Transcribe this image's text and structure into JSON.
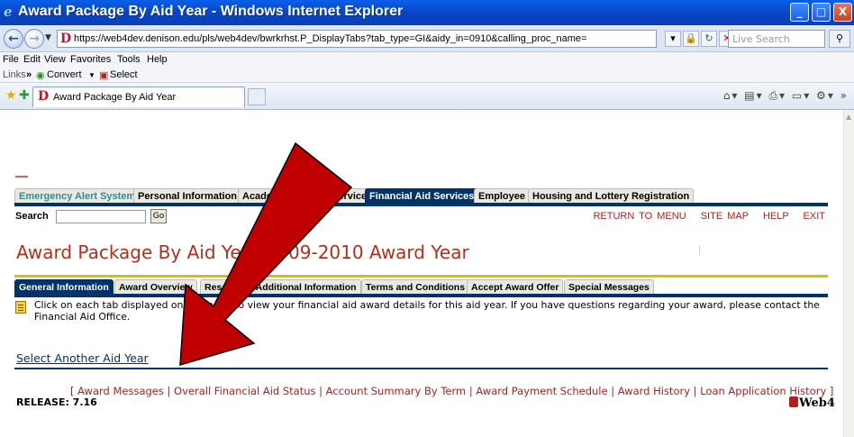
{
  "window": {
    "title": "Award Package By Aid Year - Windows Internet Explorer",
    "min_label": "_",
    "max_label": "□",
    "close_label": "X"
  },
  "address_bar": {
    "url": "https://web4dev.denison.edu/pls/web4dev/bwrkrhst.P_DisplayTabs?tab_type=GI&aidy_in=0910&calling_proc_name=",
    "search_placeholder": "Live Search"
  },
  "menu": {
    "items": [
      "File",
      "Edit",
      "View",
      "Favorites",
      "Tools",
      "Help"
    ],
    "links_label": "Links",
    "convert_label": "Convert",
    "select_label": "Select"
  },
  "browser_tab": {
    "title": "Award Package By Aid Year"
  },
  "site_tabs": [
    {
      "label": "Emergency Alert System"
    },
    {
      "label": "Personal Information"
    },
    {
      "label": "Academic/Student Services"
    },
    {
      "label": "Financial Aid Services"
    },
    {
      "label": "Employee"
    },
    {
      "label": "Housing and Lottery Registration"
    }
  ],
  "search": {
    "label": "Search",
    "go_label": "Go"
  },
  "top_links": {
    "return_to_menu": "RETURN TO MENU",
    "site_map": "SITE MAP",
    "help": "HELP",
    "exit": "EXIT"
  },
  "page_title": "Award Package By Aid Year 2009-2010 Award Year",
  "sub_tabs": [
    {
      "label": "General Information"
    },
    {
      "label": "Award Overview"
    },
    {
      "label": "Resources/Additional Information"
    },
    {
      "label": "Terms and Conditions"
    },
    {
      "label": "Accept Award Offer"
    },
    {
      "label": "Special Messages"
    }
  ],
  "info_text": "Click on each tab displayed on this page to view your financial aid award details for this aid year. If you have questions regarding your award, please contact the Financial Aid Office.",
  "select_link": "Select Another Aid Year",
  "footer_links": "[ Award Messages | Overall Financial Aid Status | Account Summary By Term | Award Payment Schedule | Award History | Loan Application History ]",
  "release": "RELEASE: 7.16",
  "logo_text": "Web4",
  "colors": {
    "accent": "#003366",
    "link": "#b01f1f",
    "arrow": "#c00000"
  }
}
